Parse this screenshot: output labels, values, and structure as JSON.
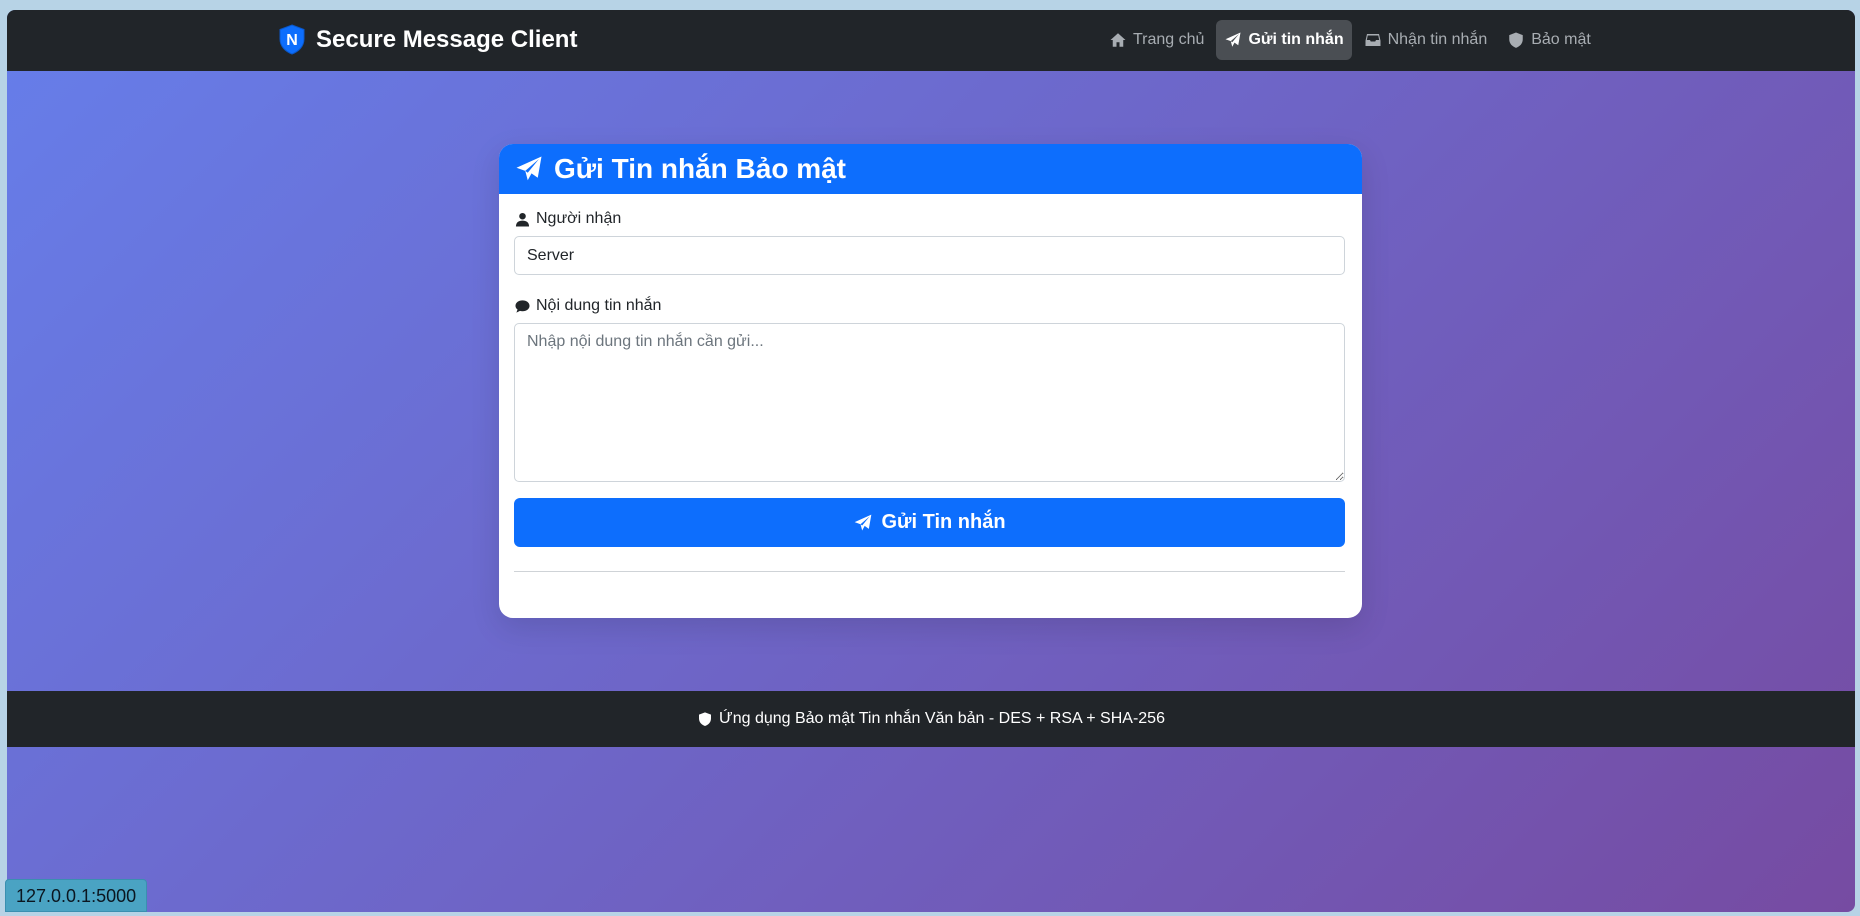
{
  "navbar": {
    "brand": "Secure Message Client",
    "brand_logo_letter": "N",
    "items": [
      {
        "label": "Trang chủ",
        "icon": "home-icon"
      },
      {
        "label": "Gửi tin nhắn",
        "icon": "paper-plane-icon",
        "active": true
      },
      {
        "label": "Nhận tin nhắn",
        "icon": "inbox-icon"
      },
      {
        "label": "Bảo mật",
        "icon": "shield-icon"
      }
    ]
  },
  "card": {
    "title": "Gửi Tin nhắn Bảo mật",
    "recipient_label": "Người nhận",
    "recipient_value": "Server",
    "message_label": "Nội dung tin nhắn",
    "message_placeholder": "Nhập nội dung tin nhắn cần gửi...",
    "send_button": "Gửi Tin nhắn"
  },
  "footer": {
    "text": "Ứng dụng Bảo mật Tin nhắn Văn bản - DES + RSA + SHA-256"
  },
  "status_bar": {
    "url": "127.0.0.1:5000"
  },
  "colors": {
    "primary": "#0d6efd",
    "navbar": "#212529",
    "gradient_start": "#667eea",
    "gradient_end": "#764ba2"
  }
}
